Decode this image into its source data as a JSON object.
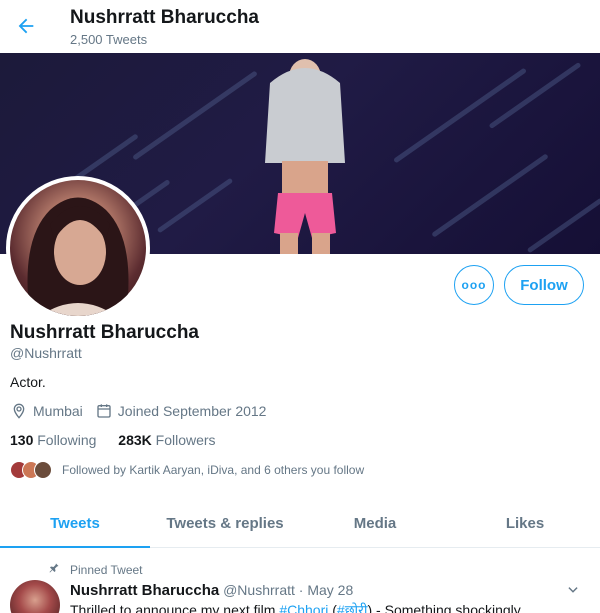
{
  "header": {
    "name": "Nushrratt Bharuccha",
    "tweet_count": "2,500 Tweets"
  },
  "profile": {
    "name": "Nushrratt Bharuccha",
    "handle": "@Nushrratt",
    "bio": "Actor.",
    "location": "Mumbai",
    "joined": "Joined September 2012",
    "following_count": "130",
    "following_label": "Following",
    "followers_count": "283K",
    "followers_label": "Followers",
    "followed_by": "Followed by Kartik Aaryan, iDiva, and 6 others you follow"
  },
  "actions": {
    "more_label": "ooo",
    "follow_label": "Follow"
  },
  "tabs": [
    {
      "label": "Tweets",
      "active": true
    },
    {
      "label": "Tweets & replies",
      "active": false
    },
    {
      "label": "Media",
      "active": false
    },
    {
      "label": "Likes",
      "active": false
    }
  ],
  "tweet": {
    "pinned_label": "Pinned Tweet",
    "author": "Nushrratt Bharuccha",
    "handle": "@Nushrratt",
    "separator": "·",
    "date": "May 28",
    "text_start": "Thrilled to announce my next film ",
    "hashtag1": "#Chhori",
    "text_mid": " (",
    "hashtag2": "#छोरी",
    "text_end": ") - Something shockingly"
  },
  "colors": {
    "accent": "#1da1f2",
    "muted": "#657786",
    "text": "#14171a"
  }
}
